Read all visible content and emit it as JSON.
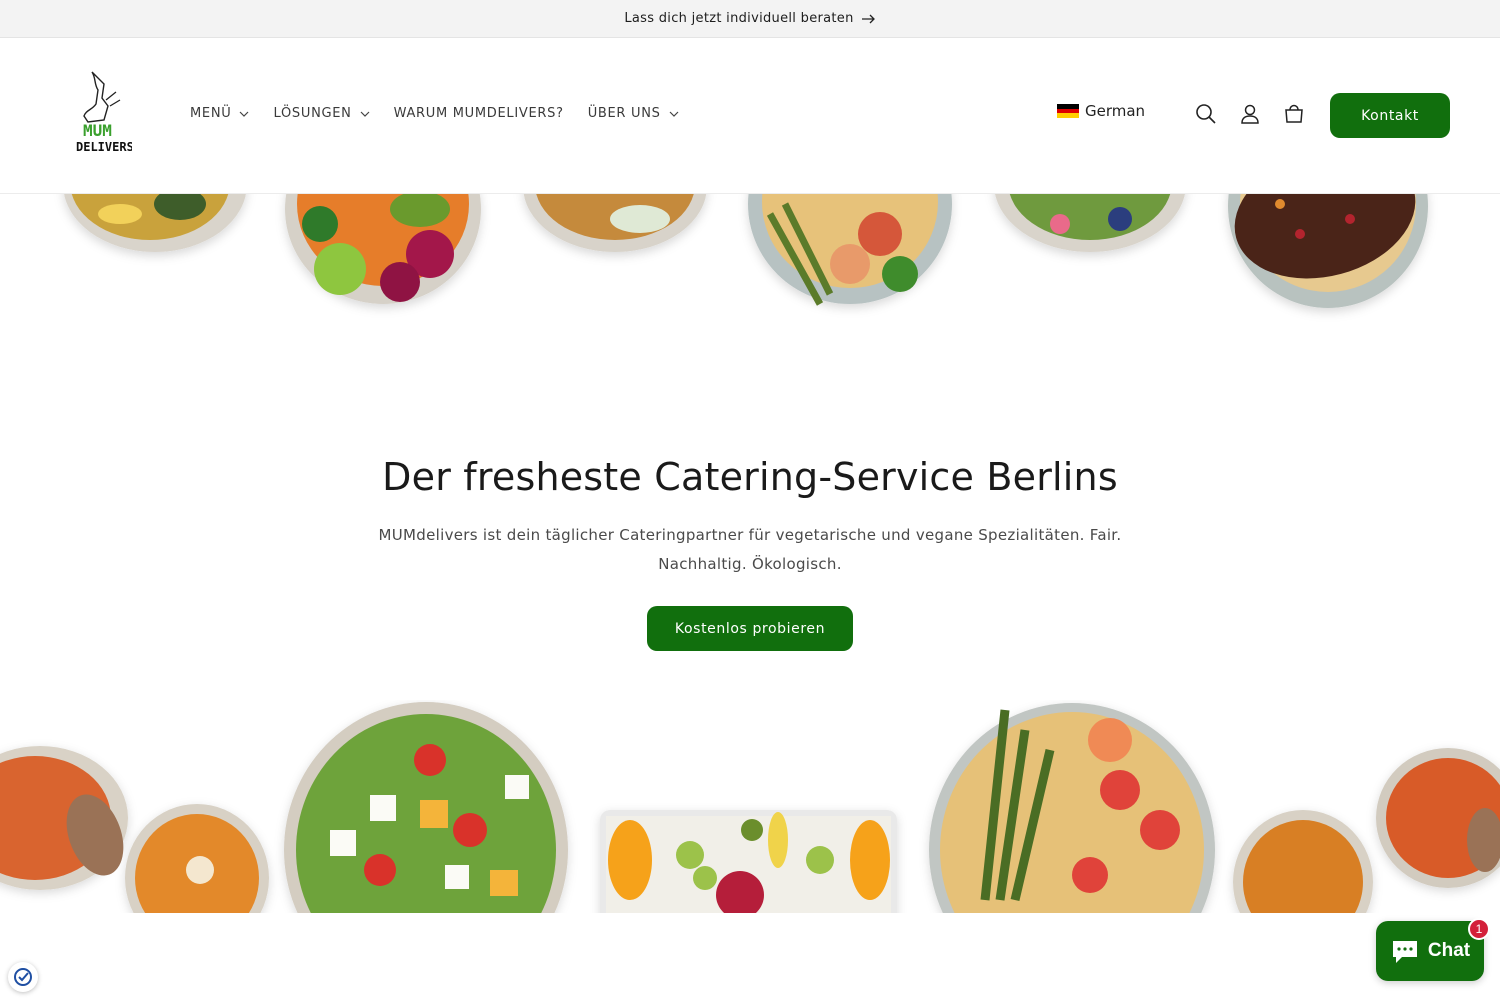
{
  "announcement": {
    "text": "Lass dich jetzt individuell beraten",
    "icon": "arrow-right-icon"
  },
  "header": {
    "logo": {
      "line1": "MUM",
      "line2": "DELIVERS"
    },
    "nav": [
      {
        "label": "MENÜ",
        "has_dropdown": true
      },
      {
        "label": "LÖSUNGEN",
        "has_dropdown": true
      },
      {
        "label": "WARUM MUMDELIVERS?",
        "has_dropdown": false
      },
      {
        "label": "ÜBER UNS",
        "has_dropdown": true
      }
    ],
    "language": {
      "label": "German",
      "flag": "german-flag-icon"
    },
    "icons": [
      "search-icon",
      "account-icon",
      "cart-icon"
    ],
    "contact_button": "Kontakt"
  },
  "hero": {
    "title": "Der fresheste Catering-Service Berlins",
    "subtitle": "MUMdelivers ist dein täglicher Cateringpartner für vegetarische und vegane Spezialitäten. Fair. Nachhaltig. Ökologisch.",
    "cta": "Kostenlos probieren"
  },
  "chat": {
    "label": "Chat",
    "badge": "1"
  },
  "colors": {
    "brand_green": "#116f0d",
    "announcement_bg": "#f3f3f3",
    "badge_red": "#d3203a"
  }
}
